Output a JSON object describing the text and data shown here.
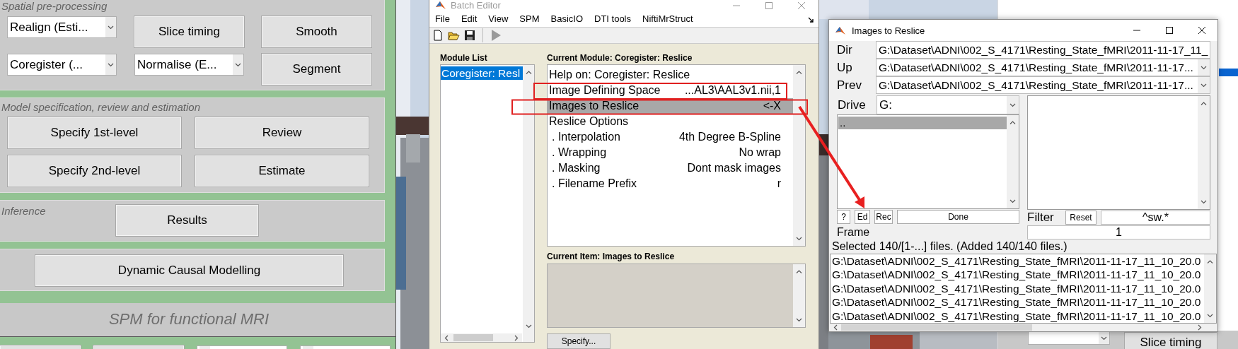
{
  "spm_panel": {
    "sections": [
      {
        "label": "Spatial pre-processing",
        "controls": [
          {
            "kind": "dropdown",
            "value": "Realign (Esti..."
          },
          {
            "kind": "button",
            "label": "Slice timing"
          },
          {
            "kind": "button",
            "label": "Smooth"
          },
          {
            "kind": "dropdown",
            "value": "Coregister (..."
          },
          {
            "kind": "dropdown",
            "value": "Normalise (E..."
          },
          {
            "kind": "button",
            "label": "Segment"
          }
        ]
      },
      {
        "label": "Model specification, review and estimation",
        "controls": [
          {
            "kind": "button",
            "label": "Specify 1st-level"
          },
          {
            "kind": "button",
            "label": "Review"
          },
          {
            "kind": "button",
            "label": "Specify 2nd-level"
          },
          {
            "kind": "button",
            "label": "Estimate"
          }
        ]
      },
      {
        "label": "Inference",
        "controls": [
          {
            "kind": "button",
            "label": "Results"
          }
        ]
      },
      {
        "controls": [
          {
            "kind": "button",
            "label": "Dynamic Causal Modelling"
          }
        ]
      }
    ],
    "title": "SPM for functional MRI",
    "bottom_controls": [
      {
        "kind": "button"
      },
      {
        "kind": "button"
      },
      {
        "kind": "dropdown"
      },
      {
        "kind": "dropdown"
      }
    ]
  },
  "batch_editor": {
    "title": "Batch Editor",
    "menu": [
      "File",
      "Edit",
      "View",
      "SPM",
      "BasicIO",
      "DTI tools",
      "NiftiMrStruct"
    ],
    "module_list": {
      "heading": "Module List",
      "items": [
        {
          "label": "Coregister: Resl",
          "selected": true
        }
      ]
    },
    "current_module": {
      "heading": "Current Module: Coregister: Reslice",
      "rows": [
        {
          "kind": "item",
          "label": "Help on: Coregister: Reslice",
          "selected": false
        },
        {
          "kind": "item",
          "label": "Image Defining Space",
          "value": "...AL3\\AAL3v1.nii,1",
          "selected": false
        },
        {
          "kind": "item",
          "label": "Images to Reslice",
          "value": "<-X",
          "selected": true
        },
        {
          "kind": "item",
          "label": "Reslice Options",
          "selected": false
        },
        {
          "kind": "option",
          "label": ". Interpolation",
          "value": "4th Degree B-Spline",
          "selected": false
        },
        {
          "kind": "option",
          "label": ". Wrapping",
          "value": "No wrap",
          "selected": false
        },
        {
          "kind": "option",
          "label": ". Masking",
          "value": "Dont mask images",
          "selected": false
        },
        {
          "kind": "option",
          "label": ". Filename Prefix",
          "value": "r",
          "selected": false
        }
      ]
    },
    "current_item": {
      "heading": "Current Item: Images to Reslice"
    },
    "specify_button": "Specify..."
  },
  "file_selector": {
    "title": "Images to Reslice",
    "paths": [
      {
        "kind": "field",
        "label": "Dir",
        "value": "G:\\Dataset\\ADNI\\002_S_4171\\Resting_State_fMRI\\2011-11-17_11_"
      },
      {
        "kind": "dropdown",
        "label": "Up",
        "value": "G:\\Dataset\\ADNI\\002_S_4171\\Resting_State_fMRI\\2011-11-17..."
      },
      {
        "kind": "dropdown",
        "label": "Prev",
        "value": "G:\\Dataset\\ADNI\\002_S_4171\\Resting_State_fMRI\\2011-11-17..."
      }
    ],
    "drive": {
      "label": "Drive",
      "value": "G:"
    },
    "dir_list": [
      {
        "label": "..",
        "selected": true
      }
    ],
    "buttons": [
      "?",
      "Ed",
      "Rec",
      "Done"
    ],
    "filter": {
      "label": "Filter",
      "reset": "Reset",
      "value": "^sw.*"
    },
    "frames": {
      "label": "Frame",
      "value": "1"
    },
    "status": "Selected 140/[1-...] files. (Added 140/140 files.)",
    "files": [
      "G:\\Dataset\\ADNI\\002_S_4171\\Resting_State_fMRI\\2011-11-17_11_10_20.0",
      "G:\\Dataset\\ADNI\\002_S_4171\\Resting_State_fMRI\\2011-11-17_11_10_20.0",
      "G:\\Dataset\\ADNI\\002_S_4171\\Resting_State_fMRI\\2011-11-17_11_10_20.0",
      "G:\\Dataset\\ADNI\\002_S_4171\\Resting_State_fMRI\\2011-11-17_11_10_20.0",
      "G:\\Dataset\\ADNI\\002_S_4171\\Resting_State_fMRI\\2011-11-17_11_10_20.0"
    ]
  },
  "background_window": {
    "button": "Slice timing"
  }
}
